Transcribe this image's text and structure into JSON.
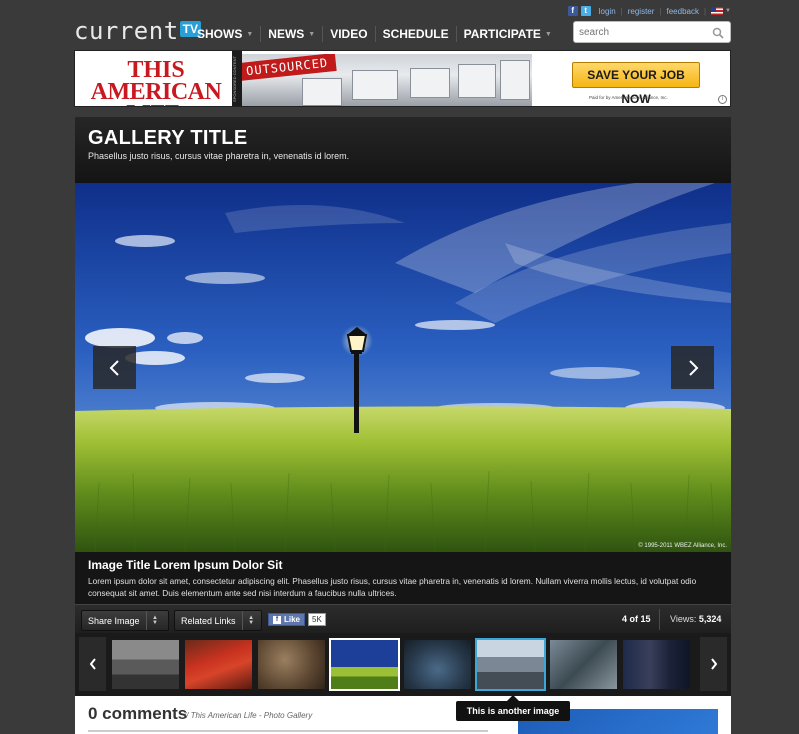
{
  "header": {
    "logo_text": "current",
    "logo_badge": "TV",
    "nav": [
      {
        "label": "SHOWS",
        "has_dropdown": true
      },
      {
        "label": "NEWS",
        "has_dropdown": true
      },
      {
        "label": "VIDEO",
        "has_dropdown": false
      },
      {
        "label": "SCHEDULE",
        "has_dropdown": false
      },
      {
        "label": "PARTICIPATE",
        "has_dropdown": true
      }
    ],
    "utility": {
      "facebook_icon": "f",
      "twitter_icon": "t",
      "login": "login",
      "register": "register",
      "feedback": "feedback",
      "separator": "|"
    },
    "search": {
      "placeholder": "search"
    }
  },
  "ad": {
    "brand_line1": "THIS",
    "brand_line2": "AMERICAN LIFE.",
    "side_strip": "SPONSORED CONTENT",
    "ribbon": "OUTSOURCED",
    "cta": "SAVE YOUR JOB NOW",
    "fine_print": "Paid for by American Jobs Alliance, Inc.",
    "info": "i"
  },
  "gallery": {
    "title": "GALLERY TITLE",
    "subtitle": "Phasellus justo risus, cursus vitae pharetra in, venenatis id lorem."
  },
  "image": {
    "copyright": "© 1995-2011 WBEZ Alliance, Inc.",
    "caption_title": "Image Title Lorem Ipsum Dolor Sit",
    "caption_text": "Lorem ipsum dolor sit amet, consectetur adipiscing elit. Phasellus justo risus, cursus vitae pharetra in, venenatis id lorem. Nullam viverra mollis lectus, id volutpat odio consequat sit amet. Duis elementum ante sed nisi interdum a faucibus nulla ultrices."
  },
  "toolbar": {
    "share_label": "Share Image",
    "related_label": "Related Links",
    "like_label": "Like",
    "like_count": "5K",
    "counter": "4 of 15",
    "views_label": "Views:",
    "views_value": "5,324"
  },
  "thumbnails": {
    "active_index": 3,
    "hover_index": 5,
    "tooltip": "This is another image",
    "items": [
      "parade",
      "bank-sign",
      "sepia-scene",
      "field-lamp",
      "aerial-dusk",
      "street-crowd",
      "tree-branches",
      "press-conference"
    ]
  },
  "comments": {
    "title": "0 comments",
    "meta": "// This American Life - Photo Gallery"
  },
  "colors": {
    "page_bg": "#3a3a3a",
    "accent_blue": "#2a9fd6",
    "active_thumb_border": "#ffffff",
    "hover_thumb_border": "#3aa7d8",
    "ad_red": "#c81820",
    "cta_yellow": "#f5b514"
  }
}
